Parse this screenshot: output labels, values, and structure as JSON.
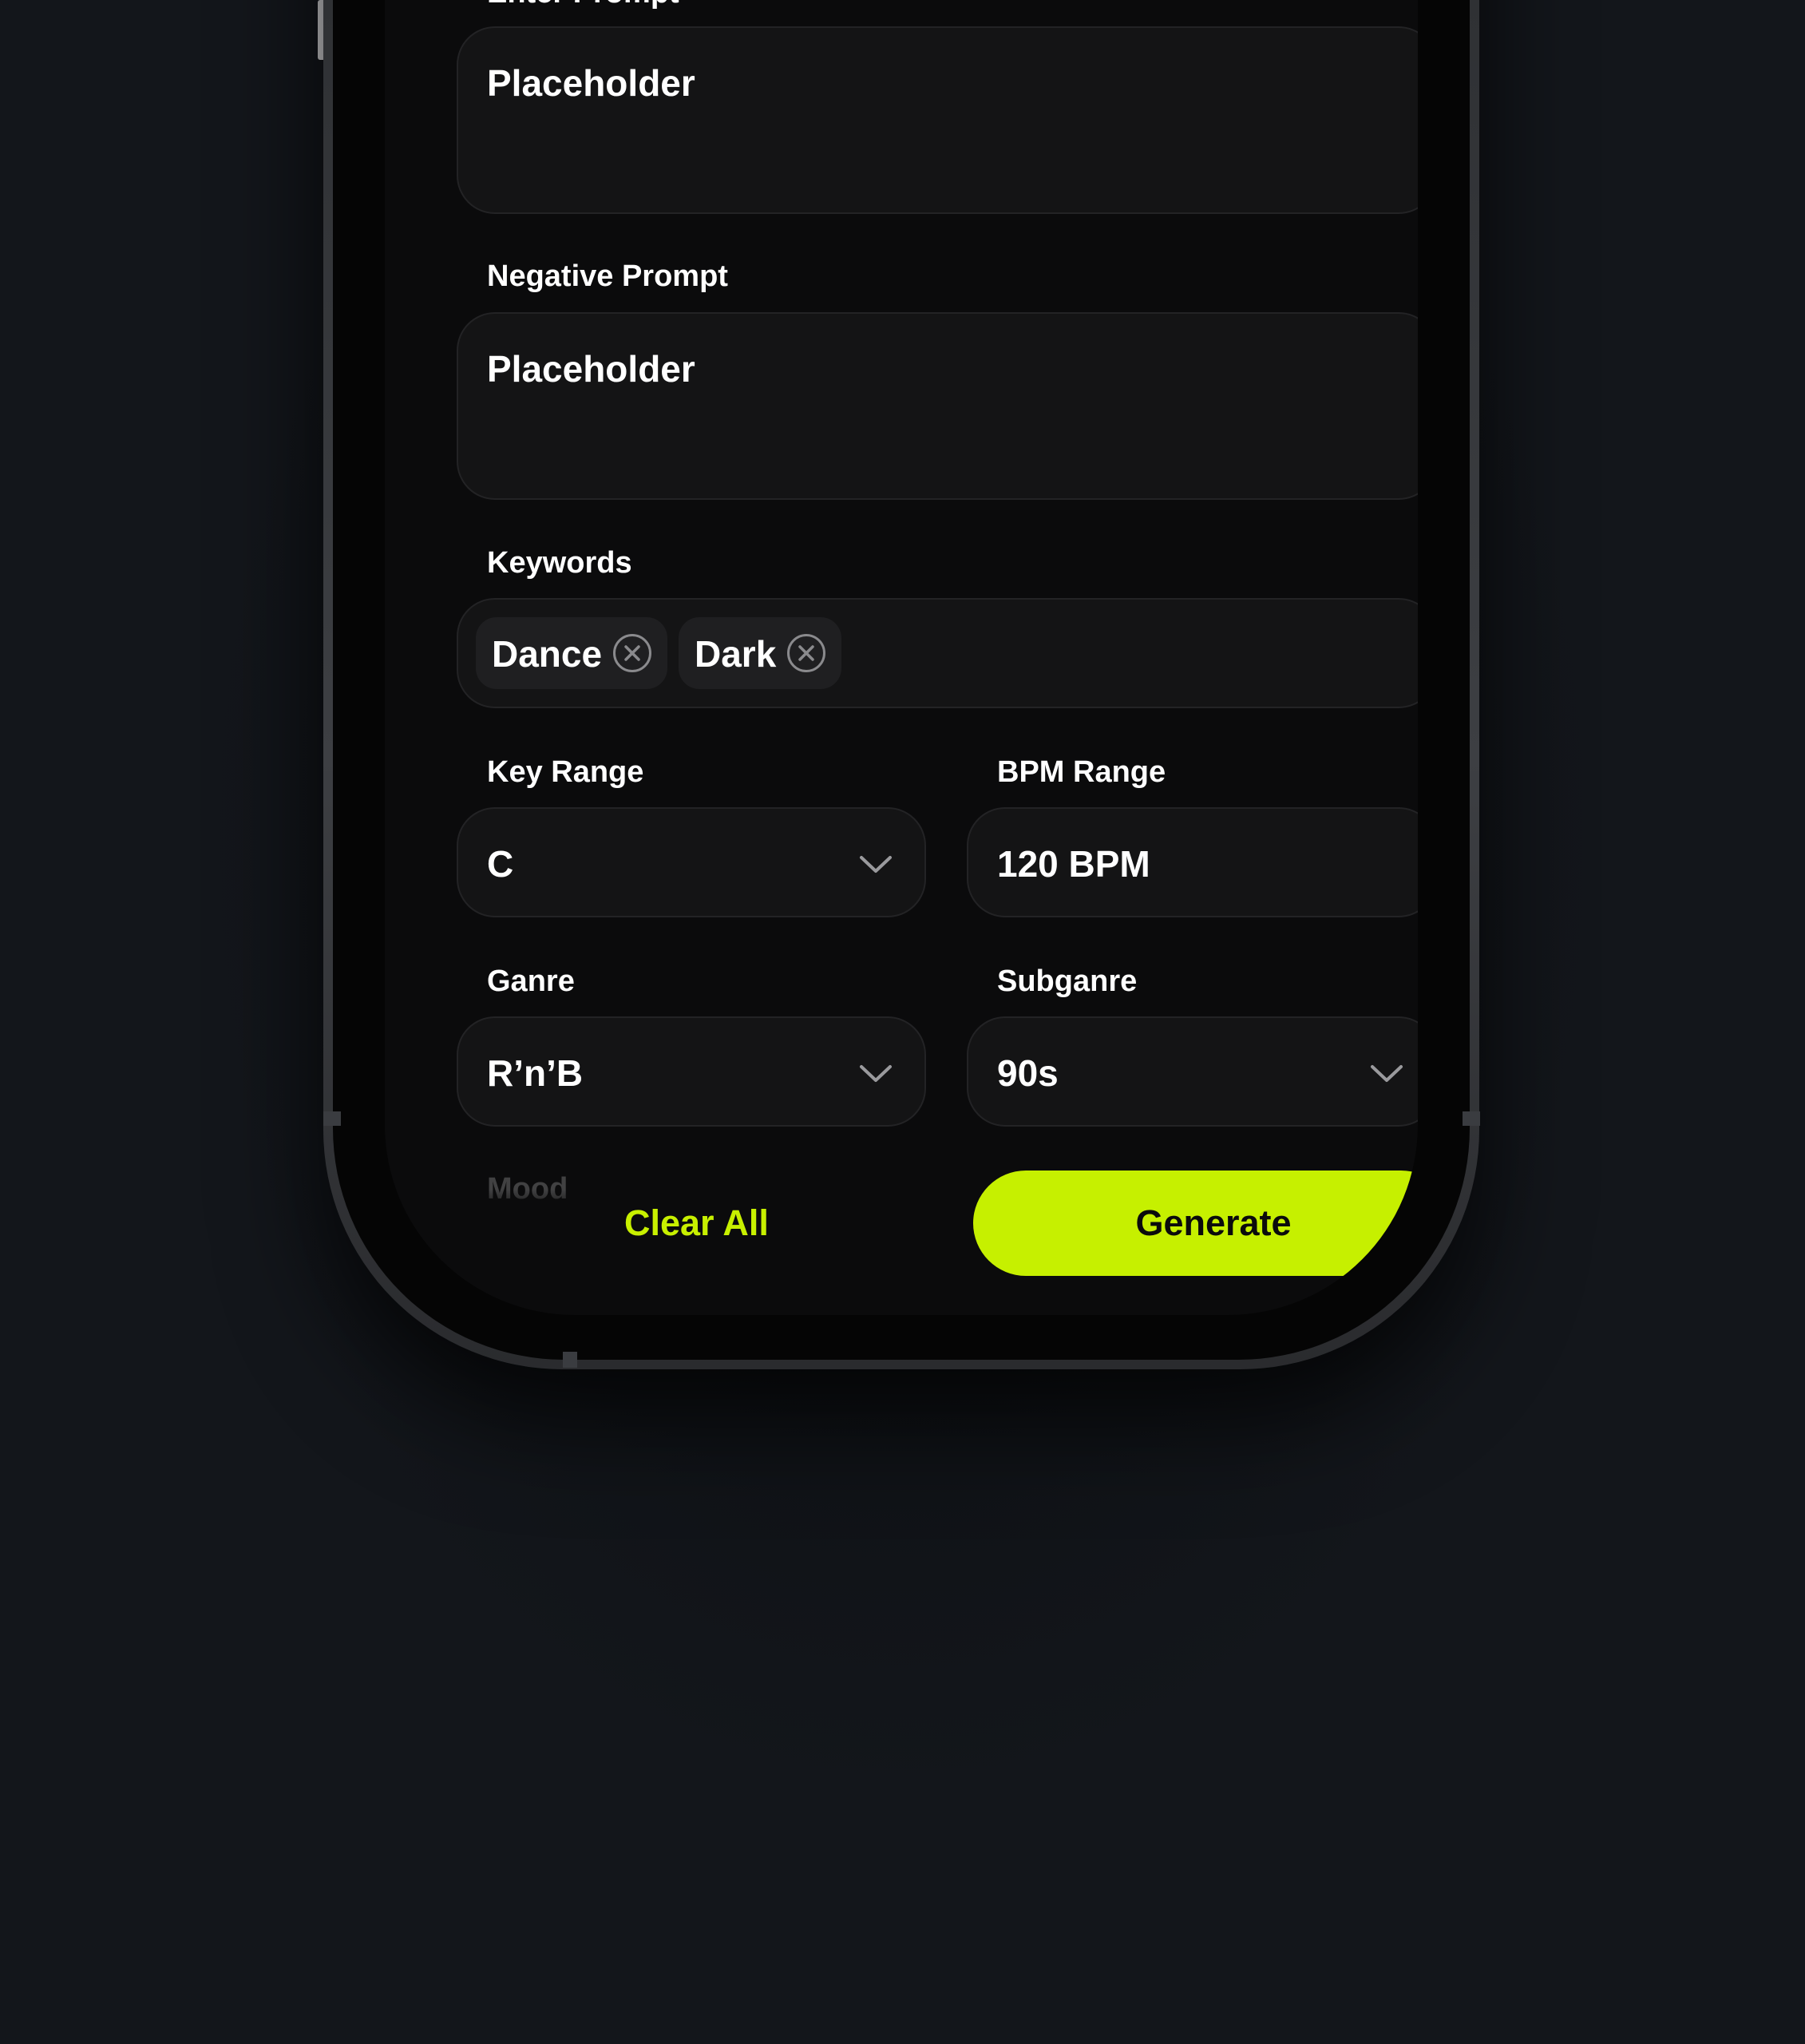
{
  "form": {
    "enter_prompt": {
      "label": "Enter Prompt",
      "value": "Placeholder"
    },
    "negative_prompt": {
      "label": "Negative Prompt",
      "value": "Placeholder"
    },
    "keywords": {
      "label": "Keywords",
      "chips": [
        {
          "text": "Dance",
          "remove_icon": "close-circle-icon"
        },
        {
          "text": "Dark",
          "remove_icon": "close-circle-icon"
        }
      ]
    },
    "key_range": {
      "label": "Key Range",
      "value": "C",
      "icon": "chevron-down-icon"
    },
    "bpm_range": {
      "label": "BPM Range",
      "value": "120 BPM"
    },
    "genre": {
      "label": "Ganre",
      "value": "R’n’B",
      "icon": "chevron-down-icon"
    },
    "subgenre": {
      "label": "Subganre",
      "value": "90s",
      "icon": "chevron-down-icon"
    },
    "mood": {
      "label": "Mood"
    }
  },
  "actions": {
    "clear_label": "Clear All",
    "generate_label": "Generate"
  },
  "colors": {
    "accent": "#c6f000",
    "background": "#13161b",
    "screen": "#0b0b0c",
    "field": "#141415",
    "chip": "#1f1f21"
  }
}
